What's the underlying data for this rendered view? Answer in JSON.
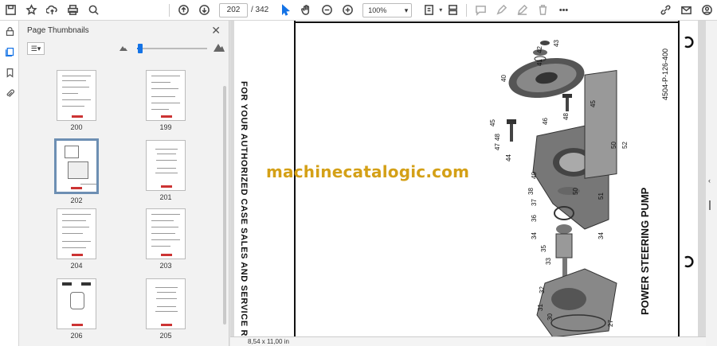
{
  "toolbar": {
    "current_page": "202",
    "total_pages": "/ 342",
    "zoom": "100%"
  },
  "panel": {
    "title": "Page Thumbnails",
    "size_slider_value": 0.05,
    "thumbnails": [
      {
        "label": "200"
      },
      {
        "label": "199"
      },
      {
        "label": "202"
      },
      {
        "label": "201"
      },
      {
        "label": "204"
      },
      {
        "label": "203"
      },
      {
        "label": "206"
      },
      {
        "label": "205"
      }
    ]
  },
  "document": {
    "watermark": "machinecatalogic.com",
    "side_text": "FOR YOUR AUTHORIZED CASE SALES AND SERVICE REPRESENTATIVE",
    "part_title": "POWER STEERING PUMP",
    "part_code": "4504-P-126-400",
    "callouts": [
      "43",
      "42",
      "41",
      "40",
      "45",
      "46",
      "48",
      "45",
      "48",
      "47",
      "44",
      "50",
      "52",
      "49",
      "38",
      "50",
      "51",
      "37",
      "36",
      "34",
      "34",
      "35",
      "33",
      "32",
      "31",
      "30",
      "27"
    ]
  },
  "statusbar": {
    "page_size": "8,54 x 11,00 in"
  },
  "colors": {
    "accent": "#1473e6",
    "watermark": "#d4a017",
    "selection": "#6d8fb3"
  }
}
